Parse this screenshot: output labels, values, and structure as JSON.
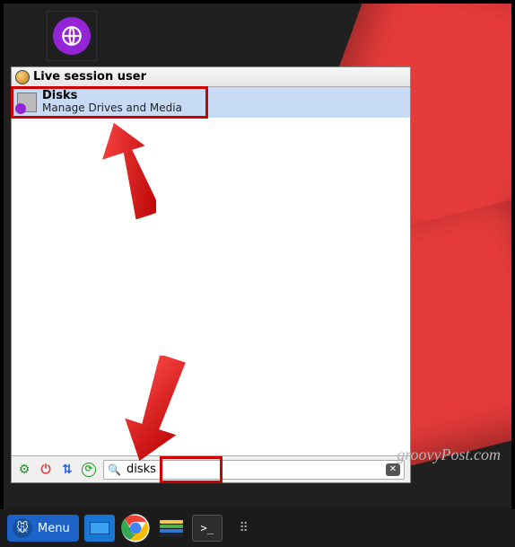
{
  "desktop": {
    "launcher_icon": "web-browser-icon"
  },
  "menu": {
    "header_title": "Live session user",
    "result": {
      "title": "Disks",
      "description": "Manage Drives and Media"
    },
    "search": {
      "value": "disks",
      "placeholder": ""
    }
  },
  "taskbar": {
    "menu_label": "Menu",
    "items": [
      "show-desktop",
      "chrome-browser",
      "file-manager",
      "terminal",
      "more-apps"
    ]
  },
  "watermark": "groovyPost.com"
}
